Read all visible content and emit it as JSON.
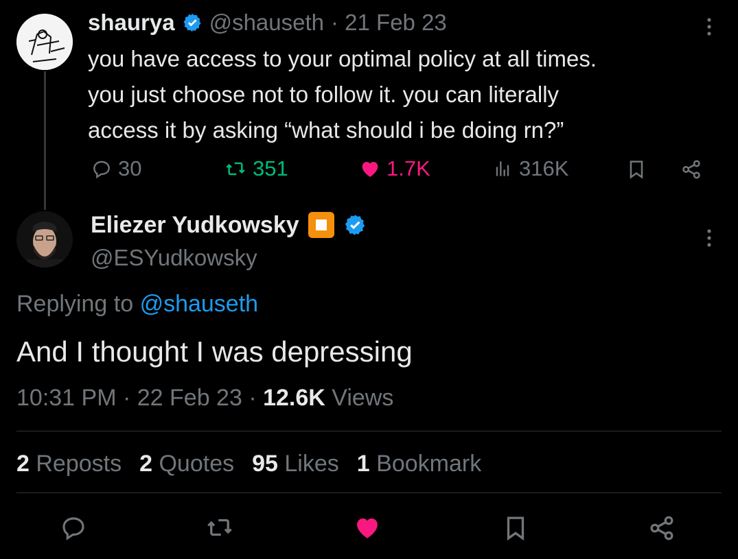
{
  "quoted_tweet": {
    "author_name": "shaurya",
    "handle": "@shauseth",
    "date": "· 21 Feb 23",
    "text_lines": [
      "you have access to your optimal policy at all times.",
      "you just choose not to follow it. you can literally",
      "access it by asking “what should i be doing rn?”"
    ],
    "replies": "30",
    "reposts": "351",
    "likes": "1.7K",
    "views": "316K",
    "icons": [
      "reply-icon",
      "repost-icon",
      "like-icon",
      "views-icon",
      "bookmark-icon",
      "share-icon",
      "more-icon",
      "verified-icon"
    ]
  },
  "main_tweet": {
    "author_name": "Eliezer Yudkowsky",
    "handle": "@ESYudkowsky",
    "replying_prefix": "Replying to",
    "replying_handle": "@shauseth",
    "text": "And I thought I was depressing",
    "time": "10:31 PM",
    "date": "· 22 Feb 23 ·",
    "views_count": "12.6K",
    "views_label": "Views",
    "stats": [
      {
        "count": "2",
        "label": "Reposts"
      },
      {
        "count": "2",
        "label": "Quotes"
      },
      {
        "count": "95",
        "label": "Likes"
      },
      {
        "count": "1",
        "label": "Bookmark"
      }
    ],
    "icons": [
      "square-emoji-icon",
      "verified-icon",
      "more-icon"
    ]
  },
  "colors": {
    "background": "#000000",
    "text": "#e7e9ea",
    "muted": "#71767b",
    "link": "#1d9bf0",
    "repost": "#00ba7c",
    "like": "#f91880",
    "verified": "#1d9bf0"
  }
}
